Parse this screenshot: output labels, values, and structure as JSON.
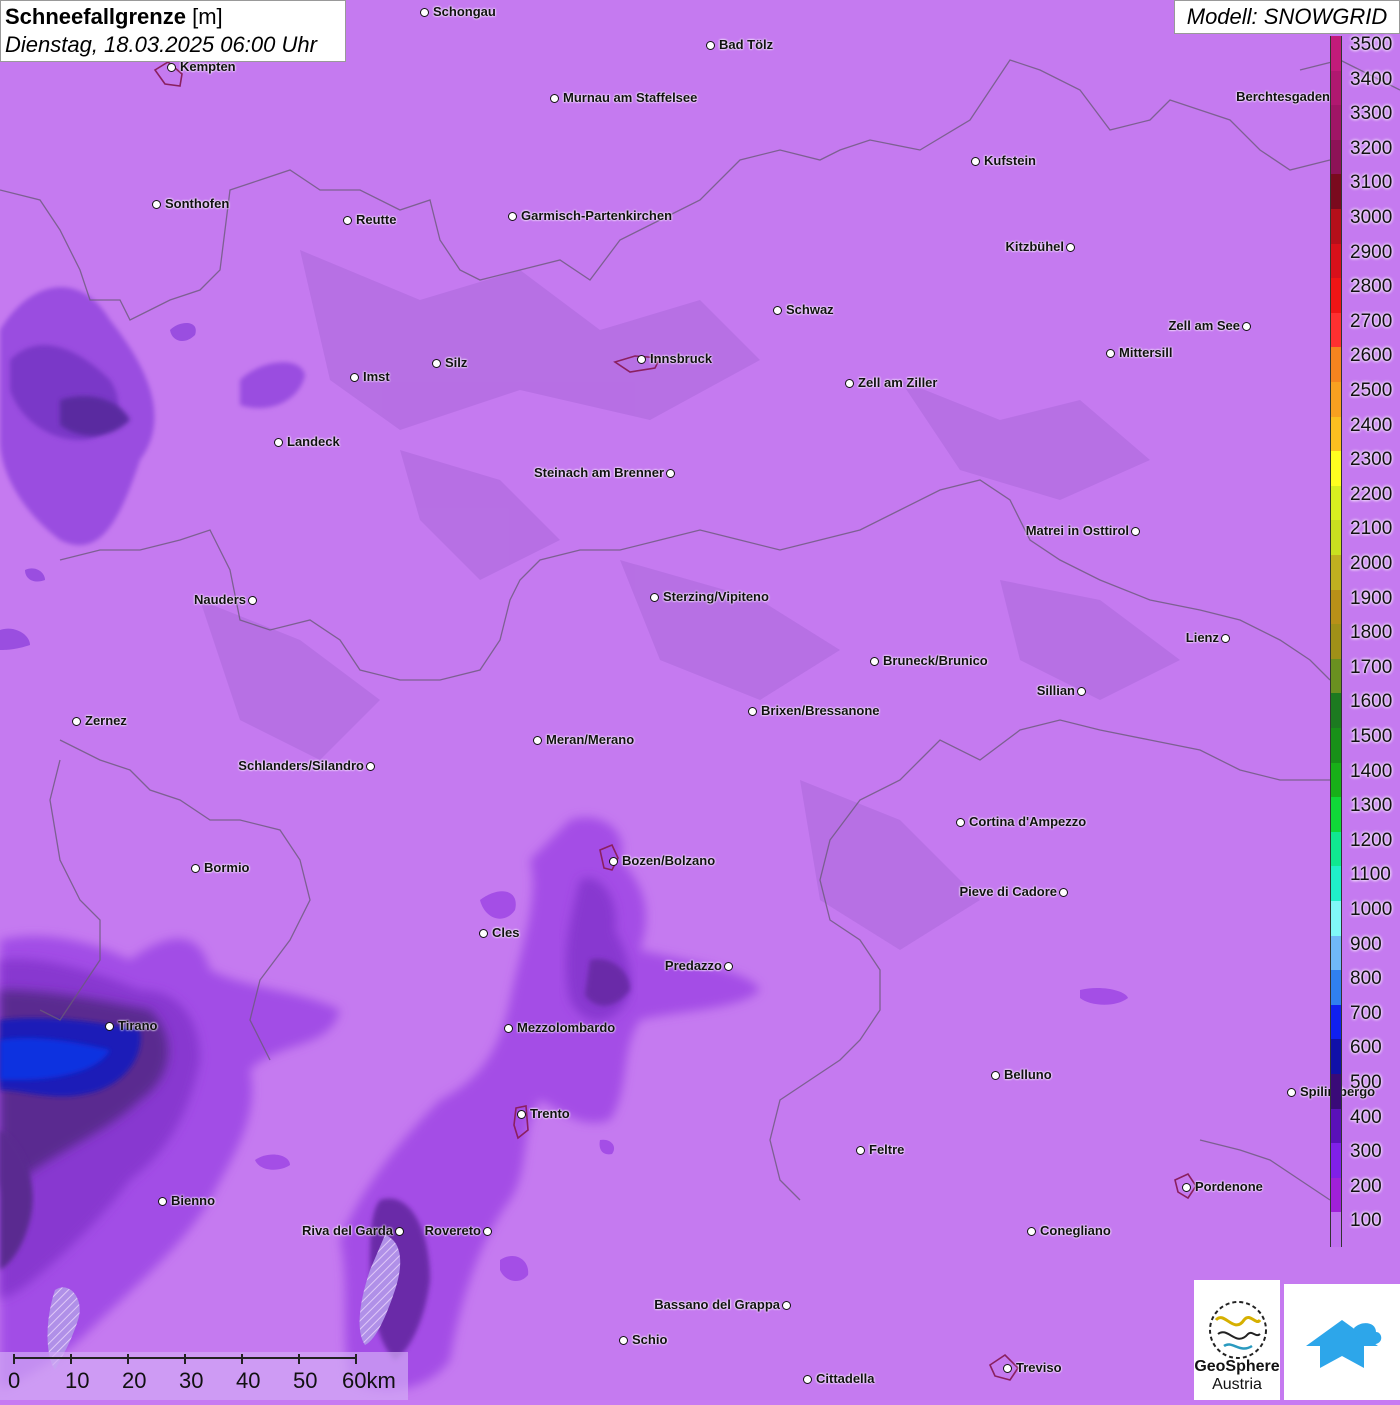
{
  "title": {
    "param": "Schneefallgrenze",
    "unit": "[m]",
    "datetime": "Dienstag, 18.03.2025 06:00 Uhr"
  },
  "model": "Modell: SNOWGRID",
  "legend": [
    {
      "label": "3500",
      "color": "#c21b7a"
    },
    {
      "label": "3400",
      "color": "#b01870"
    },
    {
      "label": "3300",
      "color": "#a01566"
    },
    {
      "label": "3200",
      "color": "#8d1257"
    },
    {
      "label": "3100",
      "color": "#7a0a1e"
    },
    {
      "label": "3000",
      "color": "#b50f1a"
    },
    {
      "label": "2900",
      "color": "#d8101a"
    },
    {
      "label": "2800",
      "color": "#f01515"
    },
    {
      "label": "2700",
      "color": "#ff3030"
    },
    {
      "label": "2600",
      "color": "#f5841f"
    },
    {
      "label": "2500",
      "color": "#f8a020"
    },
    {
      "label": "2400",
      "color": "#fbbf20"
    },
    {
      "label": "2300",
      "color": "#ffff20"
    },
    {
      "label": "2200",
      "color": "#d8f020"
    },
    {
      "label": "2100",
      "color": "#c8e020"
    },
    {
      "label": "2000",
      "color": "#c0b020"
    },
    {
      "label": "1900",
      "color": "#b89018"
    },
    {
      "label": "1800",
      "color": "#a09018"
    },
    {
      "label": "1700",
      "color": "#6a9020"
    },
    {
      "label": "1600",
      "color": "#1c7a20"
    },
    {
      "label": "1500",
      "color": "#189018"
    },
    {
      "label": "1400",
      "color": "#18b018"
    },
    {
      "label": "1300",
      "color": "#10d838"
    },
    {
      "label": "1200",
      "color": "#10e890"
    },
    {
      "label": "1100",
      "color": "#20f0c8"
    },
    {
      "label": "1000",
      "color": "#80f8f8"
    },
    {
      "label": "900",
      "color": "#70b8f8"
    },
    {
      "label": "800",
      "color": "#3080f0"
    },
    {
      "label": "700",
      "color": "#1020f0"
    },
    {
      "label": "600",
      "color": "#1010a8"
    },
    {
      "label": "500",
      "color": "#3a0a78"
    },
    {
      "label": "400",
      "color": "#5a10b8"
    },
    {
      "label": "300",
      "color": "#8020e8"
    },
    {
      "label": "200",
      "color": "#a020d8"
    },
    {
      "label": "100",
      "color": "#c070f0"
    }
  ],
  "cities": [
    {
      "name": "Schongau",
      "side": "r"
    },
    {
      "name": "Bad Tölz",
      "side": "r"
    },
    {
      "name": "Kempten",
      "side": "r"
    },
    {
      "name": "Murnau am Staffelsee",
      "side": "r"
    },
    {
      "name": "Berchtesgaden",
      "side": "l"
    },
    {
      "name": "Kufstein",
      "side": "r"
    },
    {
      "name": "Sonthofen",
      "side": "r"
    },
    {
      "name": "Reutte",
      "side": "r"
    },
    {
      "name": "Garmisch-Partenkirchen",
      "side": "r"
    },
    {
      "name": "Kitzbühel",
      "side": "l"
    },
    {
      "name": "Schwaz",
      "side": "r"
    },
    {
      "name": "Zell am See",
      "side": "l"
    },
    {
      "name": "Innsbruck",
      "side": "r"
    },
    {
      "name": "Mittersill",
      "side": "r"
    },
    {
      "name": "Imst",
      "side": "r"
    },
    {
      "name": "Silz",
      "side": "r"
    },
    {
      "name": "Zell am Ziller",
      "side": "r"
    },
    {
      "name": "Landeck",
      "side": "r"
    },
    {
      "name": "Steinach am Brenner",
      "side": "l"
    },
    {
      "name": "Matrei in Osttirol",
      "side": "l"
    },
    {
      "name": "Nauders",
      "side": "l"
    },
    {
      "name": "Sterzing/Vipiteno",
      "side": "r"
    },
    {
      "name": "Lienz",
      "side": "l"
    },
    {
      "name": "Bruneck/Brunico",
      "side": "r"
    },
    {
      "name": "Sillian",
      "side": "l"
    },
    {
      "name": "Brixen/Bressanone",
      "side": "r"
    },
    {
      "name": "Zernez",
      "side": "r"
    },
    {
      "name": "Meran/Merano",
      "side": "r"
    },
    {
      "name": "Schlanders/Silandro",
      "side": "l"
    },
    {
      "name": "Cortina d'Ampezzo",
      "side": "r"
    },
    {
      "name": "Bozen/Bolzano",
      "side": "r"
    },
    {
      "name": "Bormio",
      "side": "r"
    },
    {
      "name": "Pieve di Cadore",
      "side": "l"
    },
    {
      "name": "Cles",
      "side": "r"
    },
    {
      "name": "Predazzo",
      "side": "l"
    },
    {
      "name": "Tirano",
      "side": "r"
    },
    {
      "name": "Mezzolombardo",
      "side": "r"
    },
    {
      "name": "Belluno",
      "side": "r"
    },
    {
      "name": "Spilimbergo",
      "side": "r"
    },
    {
      "name": "Trento",
      "side": "r"
    },
    {
      "name": "Feltre",
      "side": "r"
    },
    {
      "name": "Pordenone",
      "side": "r"
    },
    {
      "name": "Bienno",
      "side": "r"
    },
    {
      "name": "Riva del Garda",
      "side": "l"
    },
    {
      "name": "Rovereto",
      "side": "l"
    },
    {
      "name": "Conegliano",
      "side": "r"
    },
    {
      "name": "Bassano del Grappa",
      "side": "l"
    },
    {
      "name": "Schio",
      "side": "r"
    },
    {
      "name": "Treviso",
      "side": "r"
    },
    {
      "name": "Cittadella",
      "side": "r"
    }
  ],
  "scale": {
    "ticks": [
      "0",
      "10",
      "20",
      "30",
      "40",
      "50",
      "60km"
    ]
  },
  "logos": {
    "geosphere": "GeoSphere",
    "austria": "Austria"
  }
}
